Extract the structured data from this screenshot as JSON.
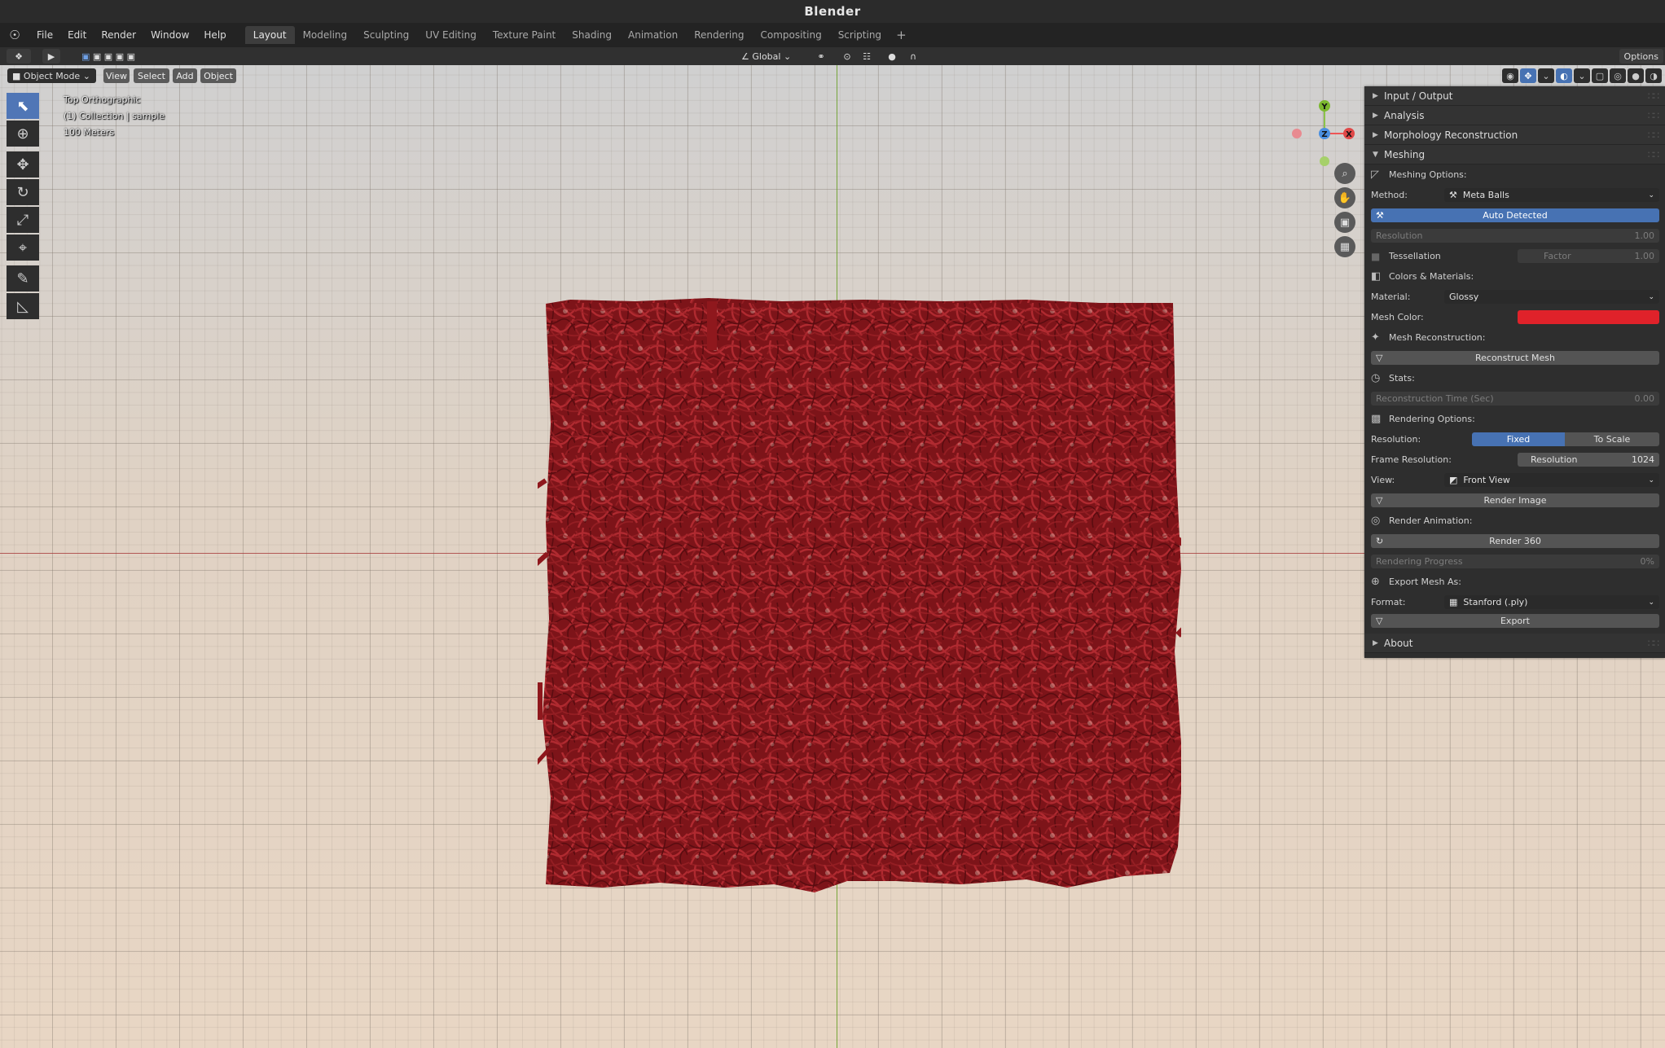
{
  "window": {
    "title": "Blender"
  },
  "menus": [
    "File",
    "Edit",
    "Render",
    "Window",
    "Help"
  ],
  "workspaces": [
    "Layout",
    "Modeling",
    "Sculpting",
    "UV Editing",
    "Texture Paint",
    "Shading",
    "Animation",
    "Rendering",
    "Compositing",
    "Scripting"
  ],
  "workspace_active": "Layout",
  "header": {
    "orientation": "Global",
    "options_label": "Options"
  },
  "viewport": {
    "mode": "Object Mode",
    "menu": [
      "View",
      "Select",
      "Add",
      "Object"
    ],
    "overlay": [
      "Top Orthographic",
      "(1) Collection | sample",
      "100 Meters"
    ],
    "gizmo": {
      "y": "Y",
      "z": "Z",
      "x": "X"
    },
    "mesh_color": "#8a1a1f"
  },
  "panel": {
    "sections": {
      "io": "Input / Output",
      "analysis": "Analysis",
      "morph": "Morphology Reconstruction",
      "meshing": "Meshing",
      "about": "About"
    },
    "meshing_options": "Meshing Options:",
    "method_label": "Method:",
    "method_value": "Meta Balls",
    "auto_detected": "Auto Detected",
    "resolution_label": "Resolution",
    "resolution_value": "1.00",
    "tessellation_label": "Tessellation",
    "factor_label": "Factor",
    "factor_value": "1.00",
    "colors_materials": "Colors & Materials:",
    "material_label": "Material:",
    "material_value": "Glossy",
    "mesh_color_label": "Mesh Color:",
    "mesh_color_value": "#e0222a",
    "mesh_reconstruction": "Mesh Reconstruction:",
    "reconstruct_button": "Reconstruct Mesh",
    "stats": "Stats:",
    "recon_time_label": "Reconstruction Time (Sec)",
    "recon_time_value": "0.00",
    "rendering_options": "Rendering Options:",
    "render_resolution_label": "Resolution:",
    "fixed": "Fixed",
    "to_scale": "To Scale",
    "frame_res_label": "Frame Resolution:",
    "frame_res_field": "Resolution",
    "frame_res_value": "1024",
    "view_label": "View:",
    "view_value": "Front View",
    "render_image": "Render Image",
    "render_animation": "Render Animation:",
    "render_360": "Render 360",
    "progress_label": "Rendering Progress",
    "progress_value": "0%",
    "export_as": "Export Mesh As:",
    "format_label": "Format:",
    "format_value": "Stanford (.ply)",
    "export_button": "Export"
  }
}
